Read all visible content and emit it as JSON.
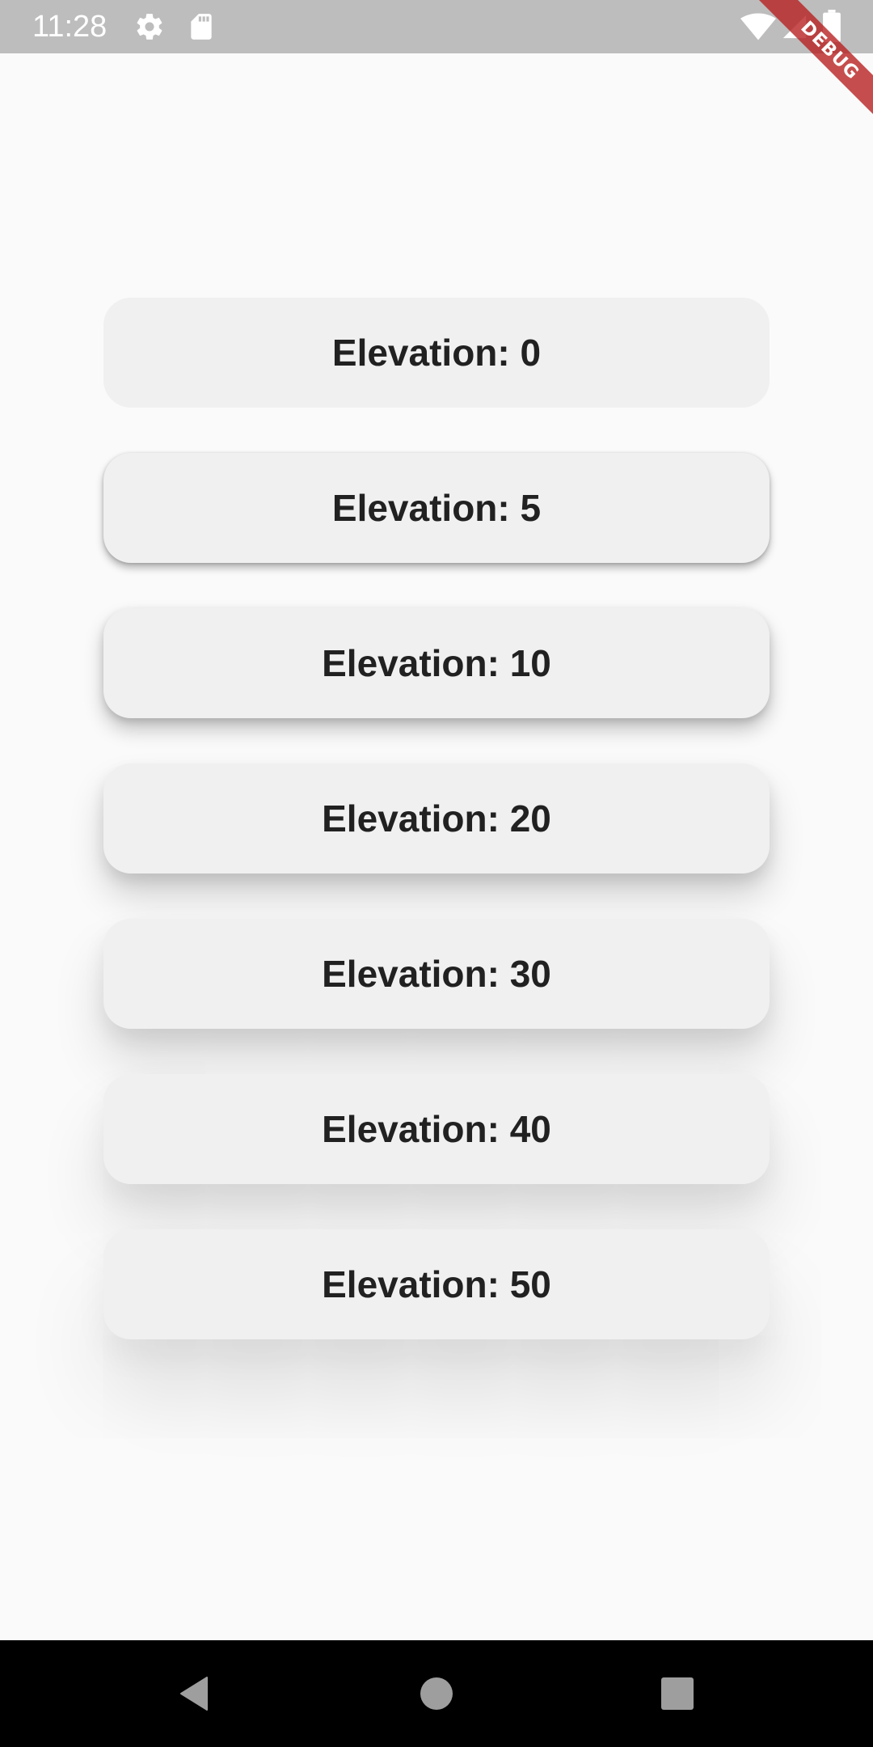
{
  "status_bar": {
    "time": "11:28",
    "icons": [
      "gear-icon",
      "sd-card-icon",
      "wifi-icon",
      "signal-icon",
      "battery-icon"
    ]
  },
  "debug_banner": {
    "label": "DEBUG",
    "color": "#b71c1c"
  },
  "cards": [
    {
      "label": "Elevation: 0"
    },
    {
      "label": "Elevation: 5"
    },
    {
      "label": "Elevation: 10"
    },
    {
      "label": "Elevation: 20"
    },
    {
      "label": "Elevation: 30"
    },
    {
      "label": "Elevation: 40"
    },
    {
      "label": "Elevation: 50"
    }
  ],
  "nav_bar": {
    "icons": [
      "back-icon",
      "home-icon",
      "recents-icon"
    ]
  },
  "colors": {
    "background": "#fafafa",
    "card": "#f0f0f0",
    "status_bar": "#bdbdbd",
    "nav_bar": "#000000",
    "text": "#212121"
  }
}
